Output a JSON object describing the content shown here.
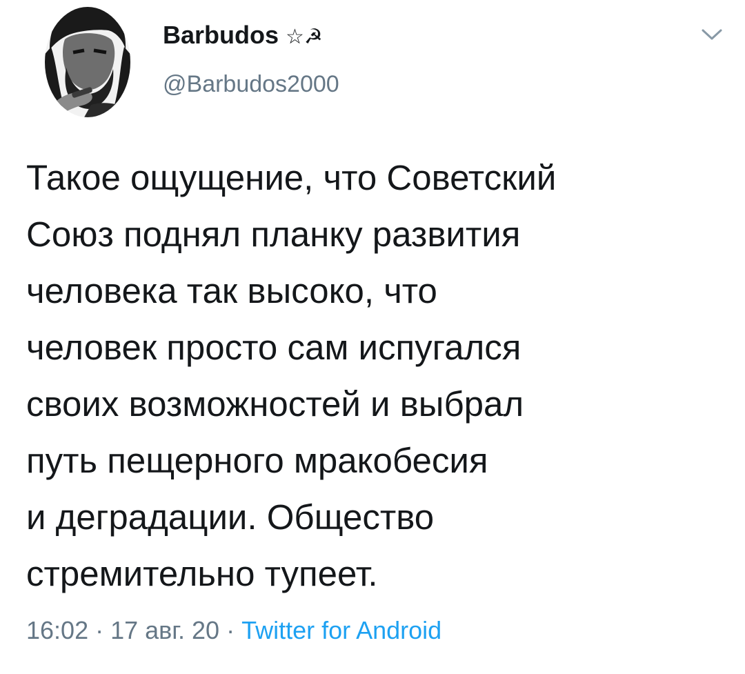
{
  "author": {
    "display_name": "Barbudos",
    "name_emoji": "☆☭",
    "handle": "@Barbudos2000"
  },
  "tweet": {
    "lines": [
      "Такое ощущение, что Советский",
      "Союз поднял планку развития",
      "человека так высоко, что",
      "человек просто сам испугался",
      "своих возможностей и выбрал",
      "путь пещерного мракобесия",
      "и деградации. Общество",
      "стремительно тупеет."
    ]
  },
  "meta": {
    "time": "16:02",
    "separator": " · ",
    "date": "17 авг. 20",
    "source": "Twitter for Android"
  },
  "icons": {
    "menu": "chevron-down-icon"
  },
  "colors": {
    "text": "#14171a",
    "secondary": "#657786",
    "link": "#1da1f2"
  }
}
